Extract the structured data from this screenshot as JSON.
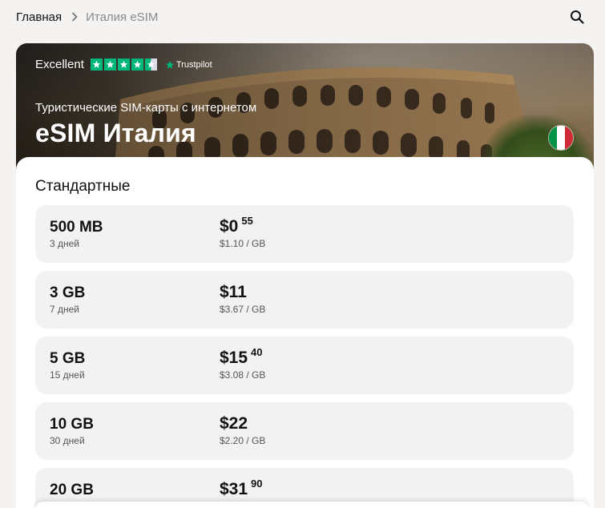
{
  "breadcrumb": {
    "home": "Главная",
    "current": "Италия eSIM"
  },
  "search": {
    "icon": "search-icon"
  },
  "hero": {
    "trust_label": "Excellent",
    "trust_stars": 4.5,
    "trust_brand": "Trustpilot",
    "subtitle": "Туристические SIM-карты с интернетом",
    "title": "eSIM Италия",
    "flag_colors": [
      "#009246",
      "#ffffff",
      "#ce2b37"
    ]
  },
  "section": {
    "title": "Стандартные"
  },
  "plans": [
    {
      "size": "500 MB",
      "days": "3 дней",
      "price": "$0",
      "cents": "55",
      "per_gb": "$1.10 / GB"
    },
    {
      "size": "3 GB",
      "days": "7 дней",
      "price": "$11",
      "cents": "",
      "per_gb": "$3.67 / GB"
    },
    {
      "size": "5 GB",
      "days": "15 дней",
      "price": "$15",
      "cents": "40",
      "per_gb": "$3.08 / GB"
    },
    {
      "size": "10 GB",
      "days": "30 дней",
      "price": "$22",
      "cents": "",
      "per_gb": "$2.20 / GB"
    },
    {
      "size": "20 GB",
      "days": "",
      "price": "$31",
      "cents": "90",
      "per_gb": ""
    }
  ],
  "colors": {
    "trustpilot_green": "#00b67a",
    "card_bg": "#f2f2f2",
    "page_bg": "#f4f3f1"
  }
}
